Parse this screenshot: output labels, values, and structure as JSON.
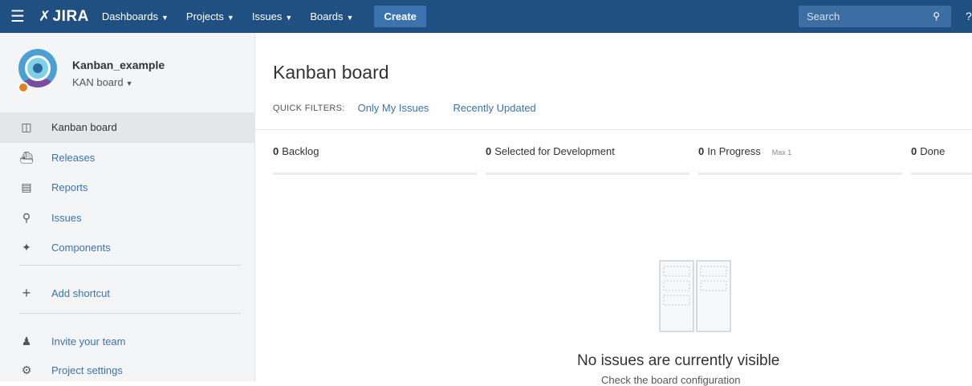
{
  "topnav": {
    "logo": "JIRA",
    "items": [
      {
        "label": "Dashboards"
      },
      {
        "label": "Projects"
      },
      {
        "label": "Issues"
      },
      {
        "label": "Boards"
      }
    ],
    "create_label": "Create",
    "search_placeholder": "Search",
    "brand_color": "#205081"
  },
  "sidebar": {
    "project_name": "Kanban_example",
    "board_selector": "KAN board",
    "items": [
      {
        "label": "Kanban board",
        "icon": "board-icon"
      },
      {
        "label": "Releases",
        "icon": "ship-icon"
      },
      {
        "label": "Reports",
        "icon": "chart-icon"
      },
      {
        "label": "Issues",
        "icon": "search-issues-icon"
      },
      {
        "label": "Components",
        "icon": "puzzle-icon"
      }
    ],
    "add_shortcut": "Add shortcut",
    "invite_team": "Invite your team",
    "project_settings": "Project settings"
  },
  "main": {
    "title": "Kanban board",
    "quick_filters_label": "QUICK FILTERS:",
    "quick_filters": [
      "Only My Issues",
      "Recently Updated"
    ],
    "columns": [
      {
        "count": "0",
        "name": "Backlog"
      },
      {
        "count": "0",
        "name": "Selected for Development"
      },
      {
        "count": "0",
        "name": "In Progress",
        "max": "Max 1"
      },
      {
        "count": "0",
        "name": "Done"
      }
    ],
    "empty_title": "No issues are currently visible",
    "empty_subtitle": "Check the board configuration"
  }
}
